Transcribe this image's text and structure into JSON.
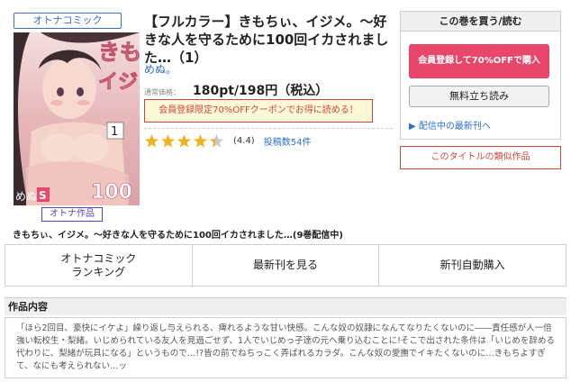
{
  "book": {
    "badge_top": "オトナコミック",
    "badge_bottom": "オトナ作品",
    "title": "【フルカラー】きもちぃ、イジメ。～好きな人を守るために100回イカされました…（1）",
    "author": "めぬ。",
    "price_label": "通常価格：",
    "price": "180pt/198円（税込）",
    "coupon": "会員登録限定70%OFFクーポンでお得に読める！",
    "rating_value": 4.4,
    "rating_text": "(4.4)",
    "reviews": "投稿数54件",
    "full_title": "きもちぃ、イジメ。～好きな人を守るために100回イカされました…(9巻配信中)",
    "cover_text": {
      "main": "きもちぃ、イジメ。",
      "volume": "1",
      "sub": "好きな人を守るために100回イカされました",
      "author": "めぬ。",
      "publisher_mark": "S"
    }
  },
  "buy_panel": {
    "header": "この巻を買う/読む",
    "register_button": "会員登録して70%OFFで購入",
    "trial_button": "無料立ち読み",
    "latest_link": "▶ 配信中の最新刊へ"
  },
  "similar_button": "このタイトルの類似作品",
  "nav": {
    "ranking_line1": "オトナコミック",
    "ranking_line2": "ランキング",
    "latest": "最新刊を見る",
    "auto_buy": "新刊自動購入"
  },
  "section_title": "作品内容",
  "description": "「ほら2回目、豪快にイケよ」繰り返し与えられる、痺れるような甘い快感。こんな奴の奴隷になんてなりたくないのに――責任感が人一倍強い転校生・梨緒。いじめられている友人を見過ごせず、1人でいじめっ子達の元へ乗り込むことに!そこで出された条件は「いじめを辞める代わりに、梨緒が玩具になる」というもので…!?皆の前でねちっこく弄ばれるカラダ。こんな奴の愛撫でイキたくないのに…きもちよすぎて、なにも考えられない…ッ",
  "colors": {
    "accent_pink": "#e8466a",
    "link_blue": "#2a6fc9",
    "star_gold": "#f0b323",
    "warning_red": "#c94a3a"
  }
}
